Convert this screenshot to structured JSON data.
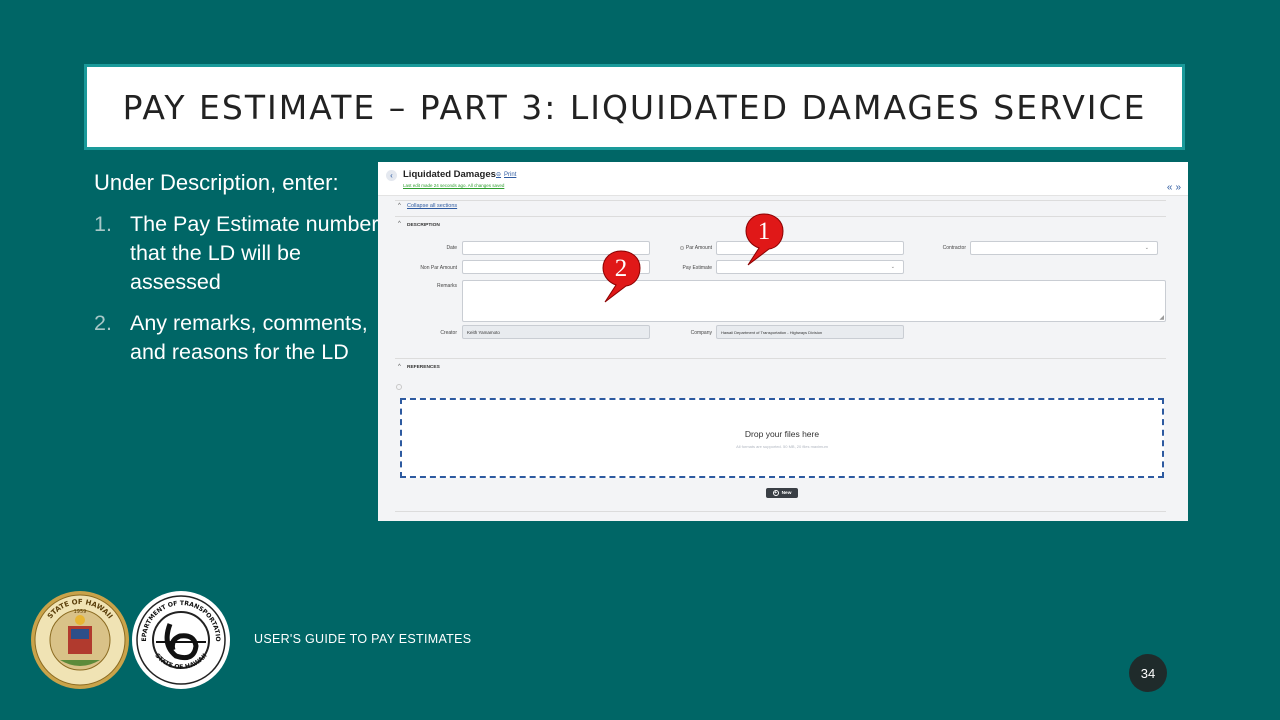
{
  "slide": {
    "title": "PAY ESTIMATE – PART 3: LIQUIDATED DAMAGES SERVICE",
    "lead": "Under Description, enter:",
    "items": [
      {
        "num": "1.",
        "text": "The Pay Estimate number that the LD will be assessed"
      },
      {
        "num": "2.",
        "text": "Any remarks, comments, and reasons for the LD"
      }
    ],
    "footer": "USER'S GUIDE TO PAY ESTIMATES",
    "page_number": "34",
    "colors": {
      "background": "#006666",
      "callout": "#e01818",
      "title_border": "#1a9a9a"
    }
  },
  "callouts": [
    {
      "label": "1",
      "icon": "red-speech-balloon"
    },
    {
      "label": "2",
      "icon": "red-speech-balloon"
    }
  ],
  "screenshot": {
    "title": "Liquidated Damages",
    "print_label": "Print",
    "saved_note": "Last edit made 24 seconds ago. All changes saved",
    "collapse_label": "Collapse all sections",
    "description_section": "DESCRIPTION",
    "references_section": "REFERENCES",
    "fields": {
      "date_label": "Date",
      "par_amount_label": "Par Amount",
      "contractor_label": "Contractor",
      "non_par_amount_label": "Non Par Amount",
      "pay_estimate_label": "Pay Estimate",
      "remarks_label": "Remarks",
      "creator_label": "Creator",
      "creator_value": "Keith Yamamoto",
      "company_label": "Company",
      "company_value": "Hawaii Department of Transportation - Highways Division"
    },
    "dropzone_title": "Drop your files here",
    "dropzone_sub": "All formats are supported. 50 MB, 20 files maximum",
    "new_button": "New"
  },
  "logos": {
    "seal_text": "STATE OF HAWAII",
    "seal_year": "1959",
    "dot_top": "DEPARTMENT OF TRANSPORTATION",
    "dot_bottom": "STATE OF HAWAII"
  }
}
